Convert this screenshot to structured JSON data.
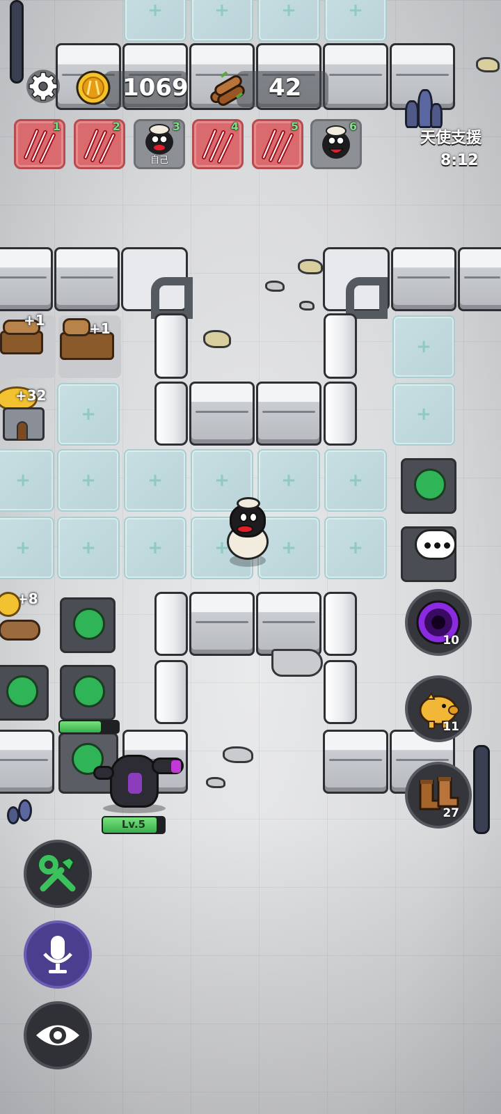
{
  "hud": {
    "gold": "1069",
    "wood": "42",
    "event_title": "天使支援",
    "event_timer": "8:12"
  },
  "players": [
    {
      "num": "1",
      "state": "attacked"
    },
    {
      "num": "2",
      "state": "attacked"
    },
    {
      "num": "3",
      "state": "self",
      "label": "自己"
    },
    {
      "num": "4",
      "state": "attacked"
    },
    {
      "num": "5",
      "state": "attacked"
    },
    {
      "num": "6",
      "state": "alive"
    }
  ],
  "board": {
    "wood_gain_1": "+1",
    "wood_gain_2": "+1",
    "gold_gain_1": "+32",
    "gold_gain_2": "+8",
    "wolf_level": "Lv.5",
    "wolf_hp_fraction": 0.88,
    "tower_hp_fraction": 0.7
  },
  "side_buttons": {
    "portal_count": "10",
    "piggy_count": "11",
    "boots_count": "27"
  },
  "colors": {
    "accent_green": "#2fb558",
    "attacked_red": "#d96a6e",
    "portal_purple": "#8a2be2"
  },
  "icons": {
    "settings": "gear-icon",
    "gold": "coin-icon",
    "wood": "wood-icon",
    "build": "wrench-hammer-icon",
    "voice": "microphone-icon",
    "view": "eye-icon",
    "chat": "chat-bubble-icon",
    "portal": "portal-icon",
    "piggy": "piggy-bank-icon",
    "boots": "boots-icon"
  }
}
